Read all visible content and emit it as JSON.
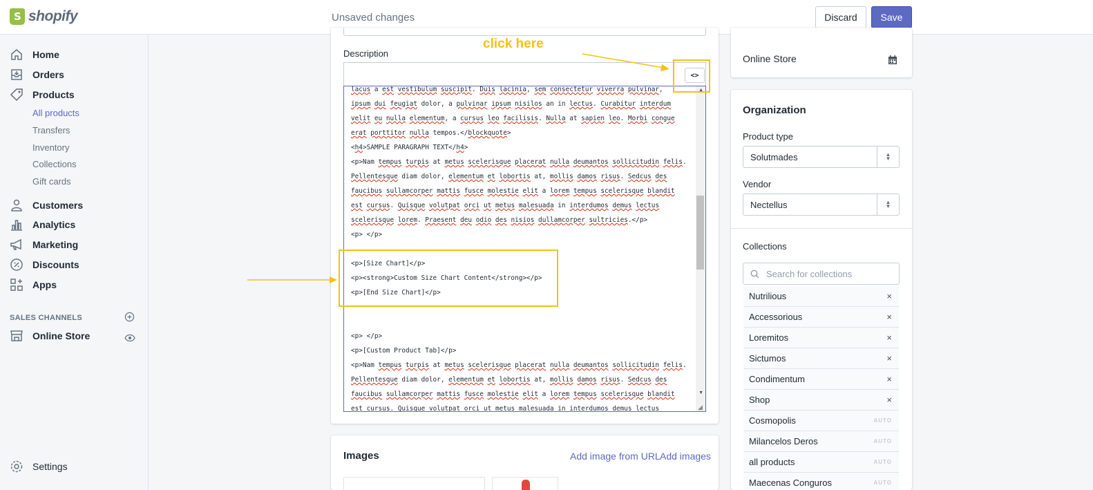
{
  "app": {
    "brand": "shopify"
  },
  "topbar": {
    "status": "Unsaved changes",
    "discard": "Discard",
    "save": "Save"
  },
  "sidebar": {
    "items": [
      {
        "label": "Home",
        "icon": "home-icon"
      },
      {
        "label": "Orders",
        "icon": "orders-icon"
      },
      {
        "label": "Products",
        "icon": "tag-icon"
      },
      {
        "label": "Customers",
        "icon": "person-icon"
      },
      {
        "label": "Analytics",
        "icon": "bar-chart-icon"
      },
      {
        "label": "Marketing",
        "icon": "megaphone-icon"
      },
      {
        "label": "Discounts",
        "icon": "discount-icon"
      },
      {
        "label": "Apps",
        "icon": "apps-icon"
      }
    ],
    "products_sub": [
      "All products",
      "Transfers",
      "Inventory",
      "Collections",
      "Gift cards"
    ],
    "sales_channels": "SALES CHANNELS",
    "online_store": "Online Store",
    "settings": "Settings"
  },
  "description": {
    "label": "Description",
    "code_button": "<>",
    "lines": [
      "lacus a est vestibulum suscipit. Duis lacinia, sem consectetur viverra pulvinar,",
      "ipsum dui feugiat dolor, a pulvinar ipsum nisilos an in lectus. Curabitur interdum",
      "velit eu nulla elementum, a cursus leo facilisis. Nulla at sapien leo. Morbi congue",
      "erat porttitor nulla tempos.</blockquote>",
      "<h4>SAMPLE PARAGRAPH TEXT</h4>",
      "<p>Nam tempus turpis at metus scelerisque placerat nulla deumantos sollicitudin felis.",
      "Pellentesque diam dolor, elementum et lobortis at, mollis damos risus. Sedcus des",
      "faucibus sullamcorper mattis fusce molestie elit a lorem tempus scelerisque blandit",
      "est cursus. Quisque volutpat orci ut metus malesuada in interdumos demus lectus",
      "scelerisque lorem. Praesent deu odio des nisios dullamcorper sultricies.</p>",
      "<p> </p>",
      "",
      "<p>[Size Chart]</p>",
      "<p><strong>Custom Size Chart Content</strong></p>",
      "<p>[End Size Chart]</p>",
      "",
      "",
      "<p> </p>",
      "<p>[Custom Product Tab]</p>",
      "<p>Nam tempus turpis at metus scelerisque placerat nulla deumantos sollicitudin felis.",
      "Pellentesque diam dolor, elementum et lobortis at, mollis damos risus. Sedcus des",
      "faucibus sullamcorper mattis fusce molestie elit a lorem tempus scelerisque blandit",
      "est cursus. Quisque volutpat orci ut metus malesuada in interdumos demus lectus"
    ]
  },
  "annotation": {
    "text": "click here",
    "color": "#f5c113"
  },
  "images": {
    "title": "Images",
    "add_url": "Add image from URL",
    "add_images": "Add images"
  },
  "right": {
    "online_store": "Online Store",
    "organization": "Organization",
    "product_type_label": "Product type",
    "product_type": "Solutmades",
    "vendor_label": "Vendor",
    "vendor": "Nectellus",
    "collections_label": "Collections",
    "collections_placeholder": "Search for collections",
    "collections": [
      {
        "name": "Nutrilious",
        "tag": "×"
      },
      {
        "name": "Accessorious",
        "tag": "×"
      },
      {
        "name": "Loremitos",
        "tag": "×"
      },
      {
        "name": "Sictumos",
        "tag": "×"
      },
      {
        "name": "Condimentum",
        "tag": "×"
      },
      {
        "name": "Shop",
        "tag": "×"
      },
      {
        "name": "Cosmopolis",
        "tag": "AUTO"
      },
      {
        "name": "Milancelos Deros",
        "tag": "AUTO"
      },
      {
        "name": "all products",
        "tag": "AUTO"
      },
      {
        "name": "Maecenas Conguros",
        "tag": "AUTO"
      }
    ]
  },
  "colors": {
    "accent": "#5c6ac4",
    "annotation": "#f5c113",
    "brand": "#95bf47"
  }
}
